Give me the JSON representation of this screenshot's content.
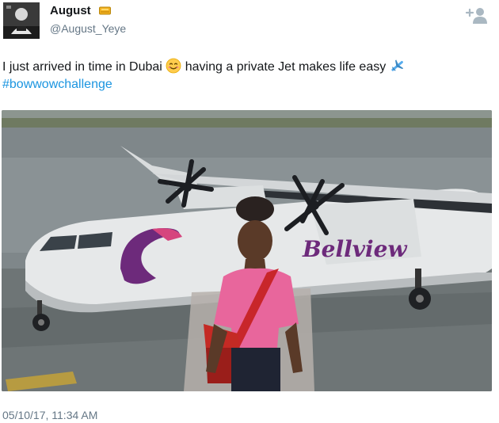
{
  "user": {
    "display_name": "August",
    "handle": "@August_Yeye",
    "name_emoji": "gold-bar-emoji",
    "avatar_icon": "profile-avatar"
  },
  "actions": {
    "follow_icon": "follow-person-plus-icon"
  },
  "tweet": {
    "text_part1": "I just arrived in time in Dubai ",
    "emoji1": "smiling-face-emoji",
    "text_part2": " having a private Jet makes life easy ",
    "emoji2": "airplane-emoji",
    "hashtag": "#bowwowchallenge"
  },
  "media": {
    "description_icon": "photo-airplane-tarmac",
    "aircraft_livery_text": "Bellview"
  },
  "meta": {
    "timestamp": "05/10/17, 11:34 AM"
  },
  "colors": {
    "link": "#1b95e0",
    "secondary": "#657786",
    "text": "#14171a",
    "follow_icon": "#aab8c2"
  }
}
